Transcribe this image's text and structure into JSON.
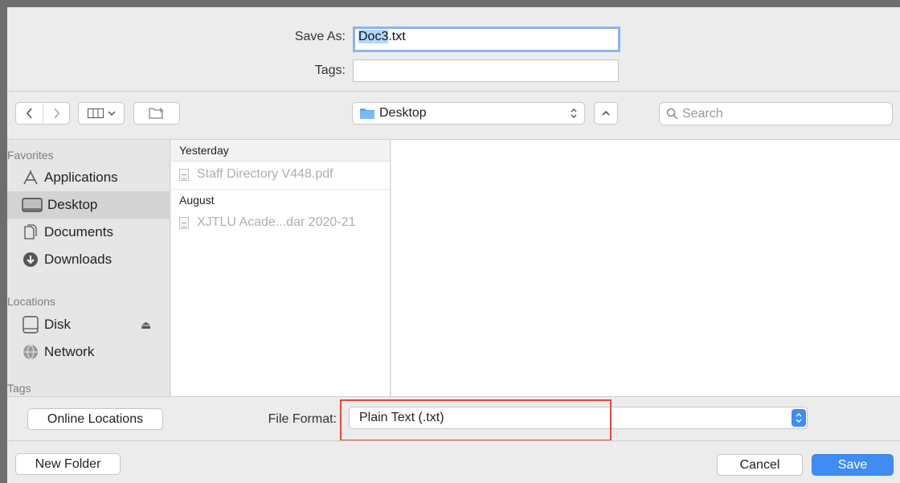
{
  "save_as": {
    "label": "Save As:",
    "filename_selected": "Doc3",
    "filename_ext": ".txt"
  },
  "tags": {
    "label": "Tags:",
    "value": ""
  },
  "toolbar": {
    "back_icon": "chevron-left-icon",
    "forward_icon": "chevron-right-icon",
    "view_icon": "column-view-icon",
    "new_folder_icon": "folder-plus-icon",
    "location": "Desktop",
    "search_placeholder": "Search"
  },
  "sidebar": {
    "favorites_header": "Favorites",
    "favorites": [
      {
        "label": "Applications",
        "icon": "applications-icon"
      },
      {
        "label": "Desktop",
        "icon": "desktop-icon",
        "active": true
      },
      {
        "label": "Documents",
        "icon": "documents-icon"
      },
      {
        "label": "Downloads",
        "icon": "downloads-icon"
      }
    ],
    "locations_header": "Locations",
    "locations": [
      {
        "label": "Disk",
        "icon": "disk-icon",
        "eject": "⏏"
      },
      {
        "label": "Network",
        "icon": "network-icon"
      }
    ],
    "tags_header": "Tags"
  },
  "file_list": {
    "groups": [
      {
        "header": "Yesterday",
        "files": [
          "Staff Directory V448.pdf"
        ]
      },
      {
        "header": "August",
        "files": [
          "XJTLU Acade...dar 2020-21"
        ]
      }
    ]
  },
  "bottom": {
    "online_locations": "Online Locations",
    "file_format_label": "File Format:",
    "file_format_value": "Plain Text (.txt)",
    "new_folder": "New Folder",
    "cancel": "Cancel",
    "save": "Save"
  },
  "colors": {
    "accent": "#3f8cf3",
    "highlight": "#e24a3b"
  }
}
